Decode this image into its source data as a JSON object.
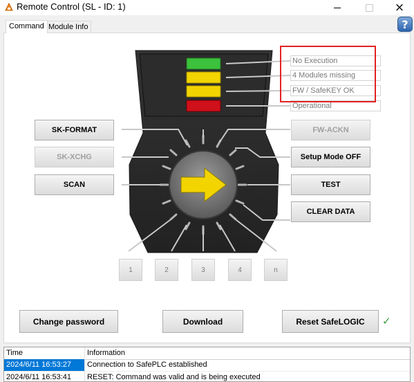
{
  "window": {
    "title": "Remote Control (SL - ID: 1)",
    "app_icon": "safelogic-app-icon",
    "controls": {
      "minimize": "minimize-icon",
      "maximize": "maximize-icon",
      "close": "×"
    }
  },
  "tabs": [
    {
      "label": "Command",
      "selected": true
    },
    {
      "label": "Module Info",
      "selected": false
    }
  ],
  "help_button": {
    "label": "?"
  },
  "status_leds": [
    {
      "color": "#3cc23c",
      "field": "No Execution"
    },
    {
      "color": "#f2d400",
      "field": "4 Modules missing"
    },
    {
      "color": "#f2d400",
      "field": "FW / SafeKEY OK"
    },
    {
      "color": "#d0101a",
      "field": "Operational"
    }
  ],
  "dial": {
    "arrow_color": "#f2d400"
  },
  "buttons": {
    "sk_format": {
      "label": "SK-FORMAT",
      "enabled": true
    },
    "sk_xchg": {
      "label": "SK-XCHG",
      "enabled": false
    },
    "scan": {
      "label": "SCAN",
      "enabled": true
    },
    "fw_ackn": {
      "label": "FW-ACKN",
      "enabled": false
    },
    "setup_mode": {
      "label": "Setup Mode OFF",
      "enabled": true
    },
    "test": {
      "label": "TEST",
      "enabled": true
    },
    "clear_data": {
      "label": "CLEAR DATA",
      "enabled": true
    },
    "num1": {
      "label": "1"
    },
    "num2": {
      "label": "2"
    },
    "num3": {
      "label": "3"
    },
    "num4": {
      "label": "4"
    },
    "numn": {
      "label": "n"
    },
    "change_password": {
      "label": "Change password"
    },
    "download": {
      "label": "Download"
    },
    "reset_safelogic": {
      "label": "Reset SafeLOGIC"
    }
  },
  "reset_status_icon": "✓",
  "log": {
    "columns": [
      "Time",
      "Information"
    ],
    "rows": [
      {
        "time": "2024/6/11 16:53:27",
        "info": "Connection to SafePLC established",
        "selected": true
      },
      {
        "time": "2024/6/11 16:53:41",
        "info": "RESET: Command was valid and is being executed",
        "selected": false
      }
    ]
  },
  "colors": {
    "highlight": "#e32222",
    "selection": "#0078d7",
    "device_body": "#2a2a2a"
  }
}
